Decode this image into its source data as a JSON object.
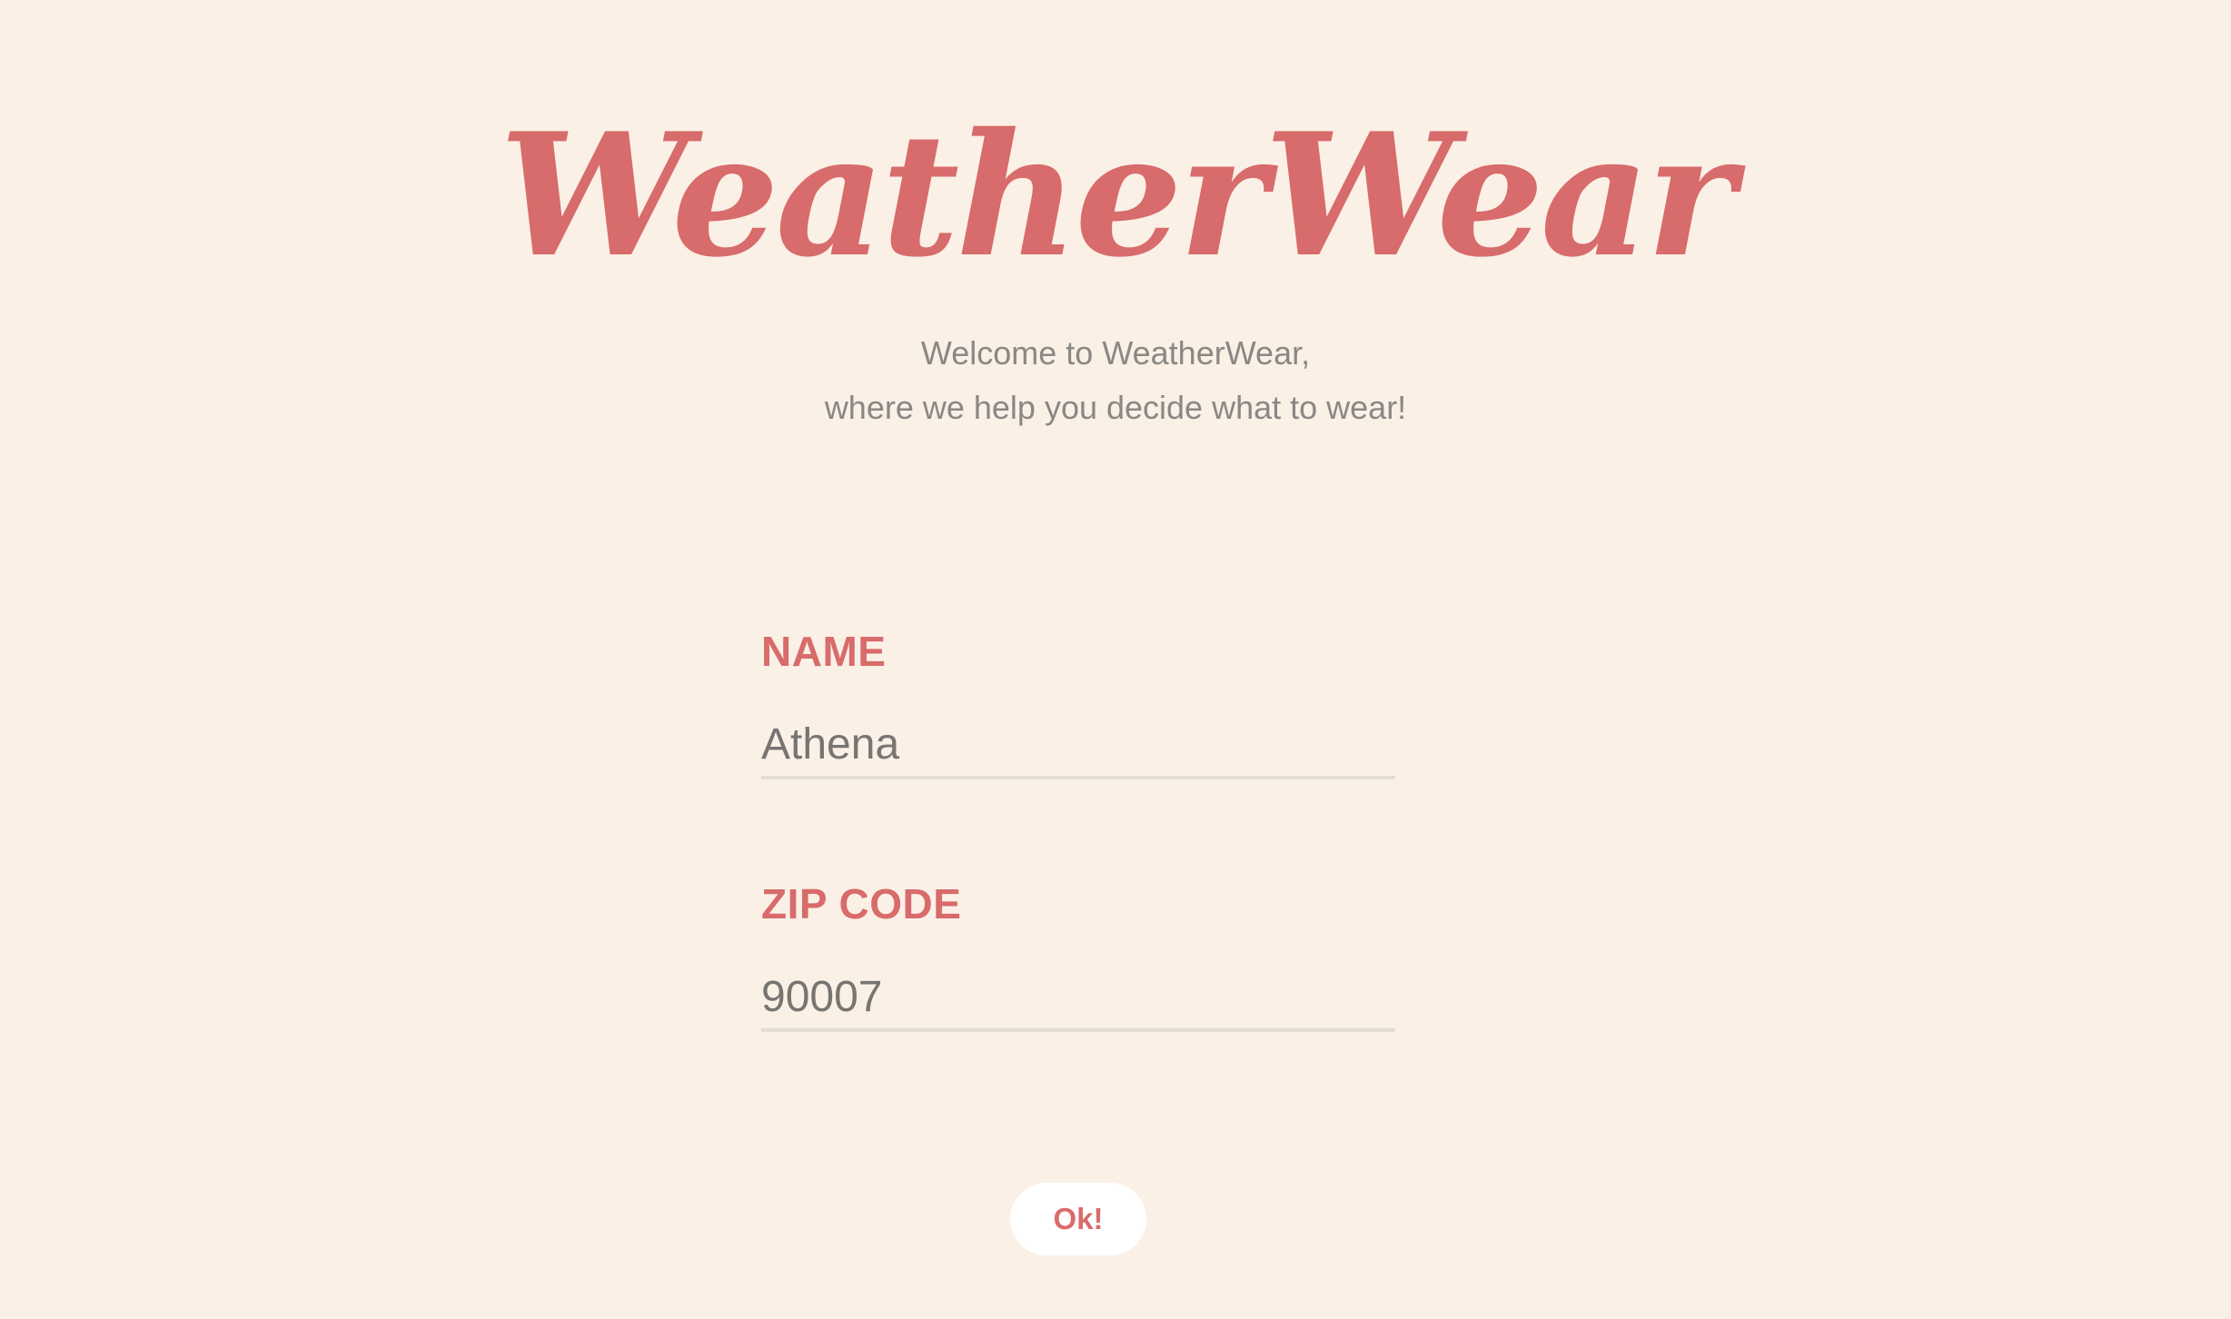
{
  "app": {
    "logo_text": "WeatherWear",
    "tagline_line1": "Welcome to WeatherWear,",
    "tagline_line2": "where we help you decide what to wear!"
  },
  "form": {
    "name_label": "NAME",
    "name_value": "Athena",
    "zip_label": "ZIP CODE",
    "zip_value": "90007",
    "submit_label": "Ok!"
  },
  "colors": {
    "background": "#faf0e6",
    "accent": "#d86b6b",
    "text_muted": "#8a8784",
    "input_text": "#777472",
    "underline": "#e4ddd6",
    "button_bg": "#ffffff"
  }
}
